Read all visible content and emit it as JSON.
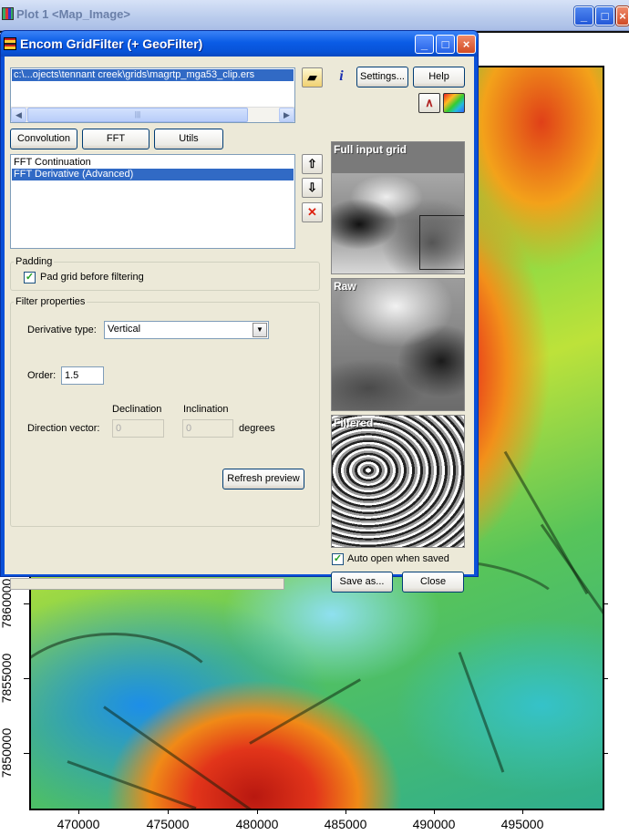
{
  "plot_window": {
    "title": "Plot 1 <Map_Image>",
    "minimize_glyph": "_",
    "maximize_glyph": "□",
    "close_glyph": "×"
  },
  "map": {
    "y_axis": {
      "ticks": [
        "7850000",
        "7855000",
        "7860000"
      ]
    },
    "x_axis": {
      "ticks": [
        "470000",
        "475000",
        "480000",
        "485000",
        "490000",
        "495000"
      ]
    }
  },
  "dialog": {
    "title": "Encom GridFilter (+ GeoFilter)",
    "file_path": "c:\\...ojects\\tennant creek\\grids\\magrtp_mga53_clip.ers",
    "buttons": {
      "settings": "Settings...",
      "help": "Help",
      "convolution": "Convolution",
      "fft": "FFT",
      "utils": "Utils",
      "refresh_preview": "Refresh preview",
      "save_as": "Save as...",
      "close": "Close"
    },
    "filter_list": [
      {
        "label": "FFT Continuation",
        "selected": false
      },
      {
        "label": "FFT Derivative (Advanced)",
        "selected": true
      }
    ],
    "padding": {
      "group_label": "Padding",
      "pad_grid_label": "Pad grid before filtering",
      "pad_grid_checked": true
    },
    "filter_properties": {
      "group_label": "Filter properties",
      "derivative_type_label": "Derivative type:",
      "derivative_type_value": "Vertical",
      "order_label": "Order:",
      "order_value": "1.5",
      "declination_label": "Declination",
      "inclination_label": "Inclination",
      "direction_vector_label": "Direction vector:",
      "declination_value": "0",
      "inclination_value": "0",
      "degrees_label": "degrees"
    },
    "previews": {
      "full_input": "Full input grid",
      "raw": "Raw",
      "filtered": "Filtered"
    },
    "auto_open_label": "Auto open when saved",
    "auto_open_checked": true
  }
}
